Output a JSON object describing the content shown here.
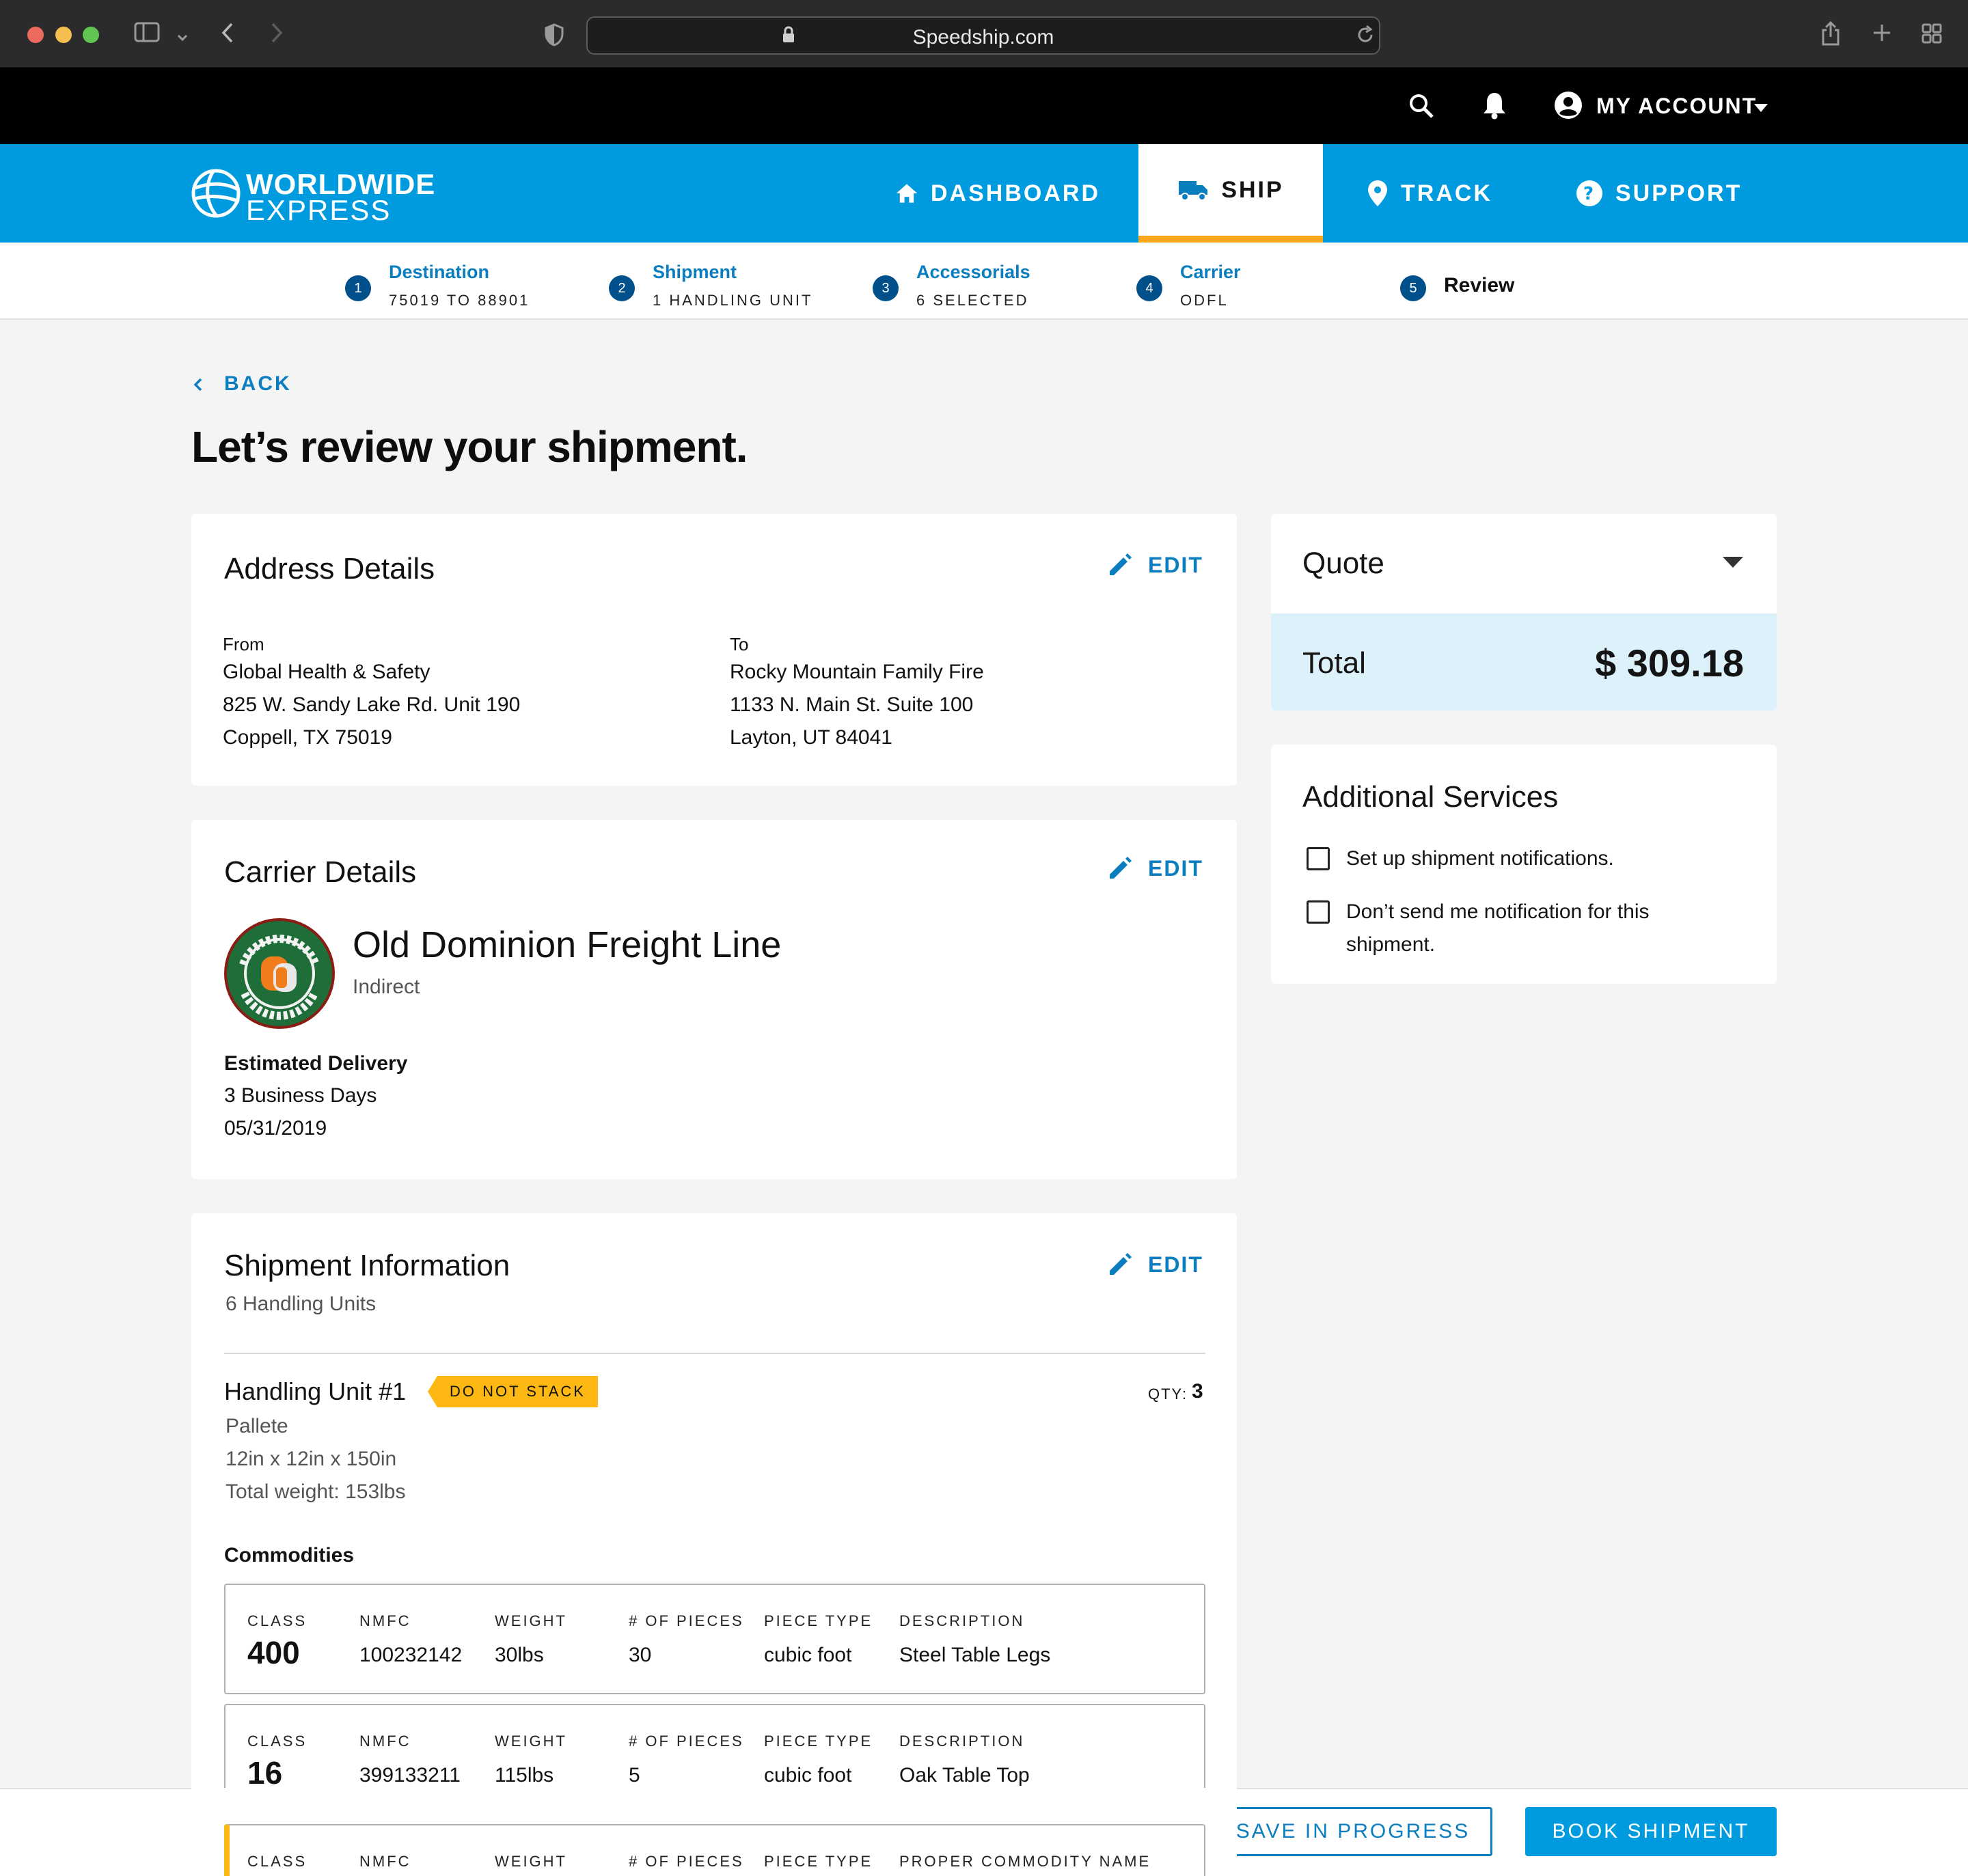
{
  "browser": {
    "url": "Speedship.com"
  },
  "topbar": {
    "account_label": "MY ACCOUNT"
  },
  "brand": {
    "line1": "WORLDWIDE",
    "line2": "EXPRESS"
  },
  "nav": {
    "dashboard": "DASHBOARD",
    "ship": "SHIP",
    "track": "TRACK",
    "support": "SUPPORT"
  },
  "steps": [
    {
      "num": "1",
      "title": "Destination",
      "sub": "75019 TO 88901"
    },
    {
      "num": "2",
      "title": "Shipment",
      "sub": "1 HANDLING UNIT"
    },
    {
      "num": "3",
      "title": "Accessorials",
      "sub": "6 SELECTED"
    },
    {
      "num": "4",
      "title": "Carrier",
      "sub": "ODFL"
    },
    {
      "num": "5",
      "title": "Review",
      "sub": ""
    }
  ],
  "page": {
    "back_label": "BACK",
    "title": "Let’s review your shipment."
  },
  "edit_label": "EDIT",
  "address": {
    "title": "Address Details",
    "from_label": "From",
    "from_name": "Global Health & Safety",
    "from_street": "825 W. Sandy Lake Rd. Unit 190",
    "from_city": "Coppell, TX 75019",
    "to_label": "To",
    "to_name": "Rocky Mountain Family Fire",
    "to_street": "1133 N. Main St. Suite 100",
    "to_city": "Layton, UT 84041"
  },
  "carrier": {
    "title": "Carrier Details",
    "name": "Old Dominion Freight Line",
    "type": "Indirect",
    "logo_text": "OLD DOMINION FREIGHT LINE",
    "delivery_label": "Estimated Delivery",
    "delivery_days": "3 Business Days",
    "delivery_date": "05/31/2019"
  },
  "shipment": {
    "title": "Shipment Information",
    "subtitle": "6 Handling Units",
    "unit_title": "Handling Unit #1",
    "badge": "DO NOT STACK",
    "qty_label": "QTY:",
    "qty": "3",
    "unit_type": "Pallete",
    "dims": "12in x 12in x 150in",
    "weight": "Total weight: 153lbs",
    "commodities_label": "Commodities",
    "columns": [
      "CLASS",
      "NMFC",
      "WEIGHT",
      "# OF PIECES",
      "PIECE TYPE",
      "DESCRIPTION"
    ],
    "third_last_column": "PROPER COMMODITY NAME",
    "rows": [
      {
        "class": "400",
        "nmfc": "100232142",
        "weight": "30lbs",
        "pieces": "30",
        "piece_type": "cubic foot",
        "description": "Steel Table Legs"
      },
      {
        "class": "16",
        "nmfc": "399133211",
        "weight": "115lbs",
        "pieces": "5",
        "piece_type": "cubic foot",
        "description": "Oak Table Top"
      }
    ]
  },
  "quote": {
    "title": "Quote",
    "total_label": "Total",
    "total_value": "$ 309.18"
  },
  "services": {
    "title": "Additional Services",
    "opt1": "Set up shipment notifications.",
    "opt2_line1": "Don’t send me notification for this",
    "opt2_line2": "shipment."
  },
  "actions": {
    "save": "SAVE IN PROGRESS",
    "book": "BOOK SHIPMENT"
  },
  "colors": {
    "brand_blue": "#009bde",
    "link_blue": "#0b7ec0",
    "step_blue": "#00508c",
    "accent_orange": "#f9a61a",
    "badge_yellow": "#fdb813"
  }
}
